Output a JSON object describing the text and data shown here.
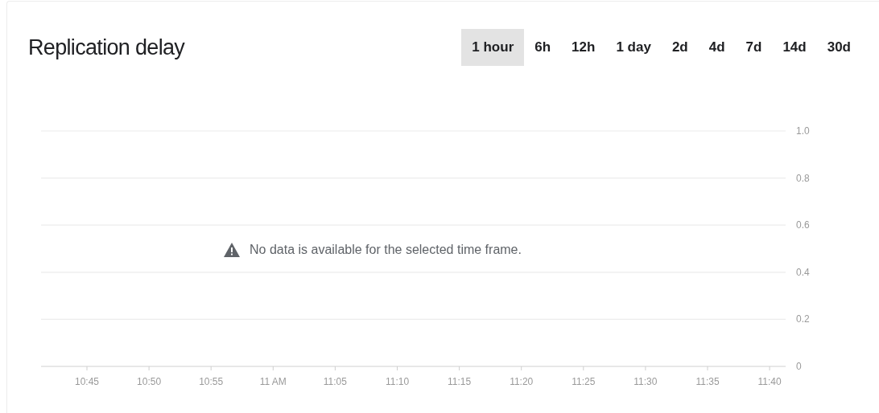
{
  "card": {
    "title": "Replication delay",
    "ranges": [
      {
        "label": "1 hour",
        "selected": true
      },
      {
        "label": "6h",
        "selected": false
      },
      {
        "label": "12h",
        "selected": false
      },
      {
        "label": "1 day",
        "selected": false
      },
      {
        "label": "2d",
        "selected": false
      },
      {
        "label": "4d",
        "selected": false
      },
      {
        "label": "7d",
        "selected": false
      },
      {
        "label": "14d",
        "selected": false
      },
      {
        "label": "30d",
        "selected": false
      }
    ],
    "message": "No data is available for the selected time frame.",
    "chart_data": {
      "type": "line",
      "grid": true,
      "values": [
        null,
        null,
        null,
        null,
        null,
        null,
        null,
        null,
        null,
        null,
        null,
        null
      ],
      "categories": [
        "10:45",
        "10:50",
        "10:55",
        "11 AM",
        "11:05",
        "11:10",
        "11:15",
        "11:20",
        "11:25",
        "11:30",
        "11:35",
        "11:40"
      ],
      "ylim": [
        0,
        1
      ],
      "yticks": [
        {
          "value": 0,
          "label": "0"
        },
        {
          "value": 0.2,
          "label": "0.2"
        },
        {
          "value": 0.4,
          "label": "0.4"
        },
        {
          "value": 0.6,
          "label": "0.6"
        },
        {
          "value": 0.8,
          "label": "0.8"
        },
        {
          "value": 1,
          "label": "1.0"
        }
      ]
    }
  }
}
